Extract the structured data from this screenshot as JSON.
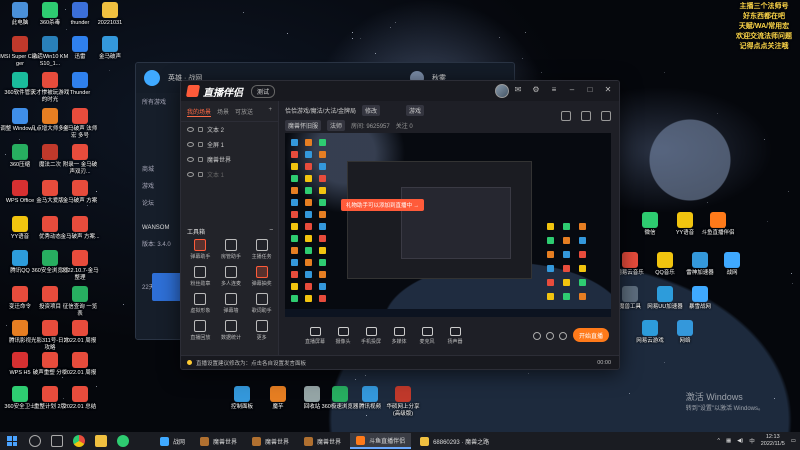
{
  "notice": {
    "lines": [
      "主播三个法师号",
      "好东西都在吧",
      "天赋/WA/常用宏",
      "欢迎交流法师问题",
      "记得点点关注哦"
    ]
  },
  "desktop": {
    "icons": [
      {
        "label": "此电脑",
        "color": "#4a90d9",
        "icon": "computer-icon"
      },
      {
        "label": "360杀毒",
        "color": "#2ecc71",
        "icon": "shield-icon"
      },
      {
        "label": "thunder",
        "color": "#3b6fd9",
        "icon": "thunder-icon"
      },
      {
        "label": "20221031",
        "color": "#f0c040",
        "icon": "folder-icon"
      },
      {
        "label": "MSI Super Charger",
        "color": "#c0392b",
        "icon": "msi-icon"
      },
      {
        "label": "激活Win10 KMS10_1...",
        "color": "#2980b9",
        "icon": "kms-icon"
      },
      {
        "label": "迅雷",
        "color": "#2f80ed",
        "icon": "thunder-icon"
      },
      {
        "label": "金马破声",
        "color": "#3498db",
        "icon": "app-icon"
      },
      {
        "label": "360软件管家",
        "color": "#1abc9c",
        "icon": "manager-icon"
      },
      {
        "label": "天才惨被玩游戏的时光",
        "color": "#e74c3c",
        "icon": "doc-icon"
      },
      {
        "label": "Thunder",
        "color": "#2f80ed",
        "icon": "thunder-icon"
      },
      {
        "label": "调整 Windows...",
        "color": "#3f8ee8",
        "icon": "settings-icon"
      },
      {
        "label": "几点增大师多号",
        "color": "#e67e22",
        "icon": "app-icon"
      },
      {
        "label": "金马破声 法师宏 多号",
        "color": "#e74c3c",
        "icon": "doc-icon"
      },
      {
        "label": "360压缩",
        "color": "#27ae60",
        "icon": "zip-icon"
      },
      {
        "label": "魔法二次",
        "color": "#c0392b",
        "icon": "doc-icon"
      },
      {
        "label": "附录一 金马破声双刃...",
        "color": "#e74c3c",
        "icon": "doc-icon"
      },
      {
        "label": "WPS Office",
        "color": "#d63031",
        "icon": "wps-icon"
      },
      {
        "label": "金马大爱版",
        "color": "#e74c3c",
        "icon": "doc-icon"
      },
      {
        "label": "金马破声 方案",
        "color": "#e74c3c",
        "icon": "doc-icon"
      },
      {
        "label": "YY语音",
        "color": "#f1c40f",
        "icon": "yy-icon"
      },
      {
        "label": "优秀动态",
        "color": "#e74c3c",
        "icon": "doc-icon"
      },
      {
        "label": "金马破声 方案...",
        "color": "#e74c3c",
        "icon": "doc-icon"
      },
      {
        "label": "腾讯QQ",
        "color": "#2d9cdb",
        "icon": "qq-icon"
      },
      {
        "label": "360安全浏览器",
        "color": "#27ae60",
        "icon": "browser-icon"
      },
      {
        "label": "2022.10.7-金马 整理",
        "color": "#e74c3c",
        "icon": "doc-icon"
      },
      {
        "label": "变迁命令",
        "color": "#e74c3c",
        "icon": "doc-icon"
      },
      {
        "label": "投资项目",
        "color": "#e74c3c",
        "icon": "doc-icon"
      },
      {
        "label": "征信查询 一览表",
        "color": "#27ae60",
        "icon": "xls-icon"
      },
      {
        "label": "腾讯影视",
        "color": "#e67e22",
        "icon": "video-icon"
      },
      {
        "label": "光影311号-日常攻略",
        "color": "#e74c3c",
        "icon": "doc-icon"
      },
      {
        "label": "2022.01 周报",
        "color": "#e74c3c",
        "icon": "doc-icon"
      },
      {
        "label": "WPS H5",
        "color": "#d63031",
        "icon": "wps-icon"
      },
      {
        "label": "破声重塑 分析",
        "color": "#e74c3c",
        "icon": "doc-icon"
      },
      {
        "label": "2022.01 周报",
        "color": "#e74c3c",
        "icon": "doc-icon"
      },
      {
        "label": "360安全卫士",
        "color": "#2ecc71",
        "icon": "guard-icon"
      },
      {
        "label": "重整计划 2版",
        "color": "#e74c3c",
        "icon": "doc-icon"
      },
      {
        "label": "2022.01 总结",
        "color": "#e74c3c",
        "icon": "doc-icon"
      },
      {
        "label": "微信",
        "color": "#2ecc71",
        "icon": "wechat-icon"
      },
      {
        "label": "YY语音",
        "color": "#f1c40f",
        "icon": "yy-icon"
      },
      {
        "label": "斗鱼直播伴侣",
        "color": "#ff7a1a",
        "icon": "douyu-icon"
      },
      {
        "label": "网易云音乐",
        "color": "#e74c3c",
        "icon": "music-icon"
      },
      {
        "label": "QQ音乐",
        "color": "#f1c40f",
        "icon": "music-icon"
      },
      {
        "label": "雷神加速器",
        "color": "#3498db",
        "icon": "boost-icon"
      },
      {
        "label": "战网",
        "color": "#3fa9ff",
        "icon": "battlenet-icon"
      },
      {
        "label": "魔兽工具",
        "color": "#5d6d7e",
        "icon": "tool-icon"
      },
      {
        "label": "网易UU加速器",
        "color": "#2d9cdb",
        "icon": "boost-icon"
      },
      {
        "label": "暴雪战网",
        "color": "#3fa9ff",
        "icon": "battlenet-icon"
      },
      {
        "label": "网易云游戏",
        "color": "#2d9cdb",
        "icon": "cloud-icon"
      },
      {
        "label": "网络",
        "color": "#3498db",
        "icon": "network-icon"
      },
      {
        "label": "控制面板",
        "color": "#3498db",
        "icon": "control-panel-icon"
      },
      {
        "label": "魔芋",
        "color": "#e67e22",
        "icon": "folder-icon"
      },
      {
        "label": "回收站",
        "color": "#95a5a6",
        "icon": "recycle-bin-icon"
      },
      {
        "label": "360极速浏览器",
        "color": "#27ae60",
        "icon": "browser-icon"
      },
      {
        "label": "腾讯视频",
        "color": "#3498db",
        "icon": "video-icon"
      },
      {
        "label": "华硕网上分享 (高级版)",
        "color": "#c0392b",
        "icon": "gift-icon"
      }
    ]
  },
  "back_window": {
    "title": "英雄 · 战网",
    "sidebar": [
      "所有游戏",
      "商城",
      "游戏",
      "论坛"
    ],
    "user": "秋雾",
    "button": "进入",
    "side_text": [
      "WANSOM",
      "版本: 3.4.0",
      "22天"
    ]
  },
  "app": {
    "brand": "直播伴侣",
    "brand_badge": "测试",
    "window_controls": [
      "minimize-icon",
      "maximize-icon",
      "close-icon"
    ],
    "scene_tabs": [
      "我的场景",
      "场景",
      "可放送",
      "+"
    ],
    "sources": [
      {
        "label": "文本 2",
        "dim": false
      },
      {
        "label": "全屏 1",
        "dim": false
      },
      {
        "label": "魔兽世界",
        "dim": false
      },
      {
        "label": "文本 1",
        "dim": true
      }
    ],
    "toolbox_title": "工具箱",
    "tools": [
      {
        "label": "弹幕助手",
        "red": true
      },
      {
        "label": "房管助手",
        "red": false
      },
      {
        "label": "主播任务",
        "red": false
      },
      {
        "label": "粉丝勋章",
        "red": false
      },
      {
        "label": "多人连麦",
        "red": false
      },
      {
        "label": "弹幕抽奖",
        "red": true
      },
      {
        "label": "虚拟形象",
        "red": false
      },
      {
        "label": "弹幕墙",
        "red": false
      },
      {
        "label": "歌词助手",
        "red": false
      },
      {
        "label": "直播回放",
        "red": false
      },
      {
        "label": "数据统计",
        "red": false
      },
      {
        "label": "更多",
        "red": false
      }
    ],
    "info": {
      "title": "恰恰游戏/魔法/大法/金牌局",
      "edit": "修改",
      "category": "游戏",
      "tag1": "魔兽怀旧服",
      "tag2": "法师",
      "room": "房间: 9625957",
      "fans": "关注 0"
    },
    "preview_tip": "礼物助手可以添加到直播中 →",
    "controls": [
      {
        "label": "直播屏幕",
        "icon": "screen-icon"
      },
      {
        "label": "摄像头",
        "icon": "camera-icon"
      },
      {
        "label": "手机投屏",
        "icon": "phone-icon"
      },
      {
        "label": "多媒体",
        "icon": "media-icon"
      },
      {
        "label": "麦克风",
        "icon": "mic-icon"
      },
      {
        "label": "扬声器",
        "icon": "speaker-icon"
      }
    ],
    "start_button": "开始直播",
    "status_text": "直播设置建议修改为：点击各自设置发言面板",
    "status_time": "00:00"
  },
  "activate": {
    "line1": "激活 Windows",
    "line2": "转到\"设置\"以激活 Windows。"
  },
  "taskbar": {
    "tasks": [
      {
        "label": "战网",
        "color": "#3fa9ff",
        "active": false
      },
      {
        "label": "魔兽世界",
        "color": "#b07030",
        "active": false
      },
      {
        "label": "魔兽世界",
        "color": "#b07030",
        "active": false
      },
      {
        "label": "魔兽世界",
        "color": "#b07030",
        "active": false
      },
      {
        "label": "斗鱼直播伴侣",
        "color": "#ff7a1a",
        "active": true
      },
      {
        "label": "68860293 · 魔兽之路",
        "color": "#f0c040",
        "active": false
      }
    ],
    "time": "12:13",
    "date": "2022/11/5",
    "ime": "中"
  }
}
